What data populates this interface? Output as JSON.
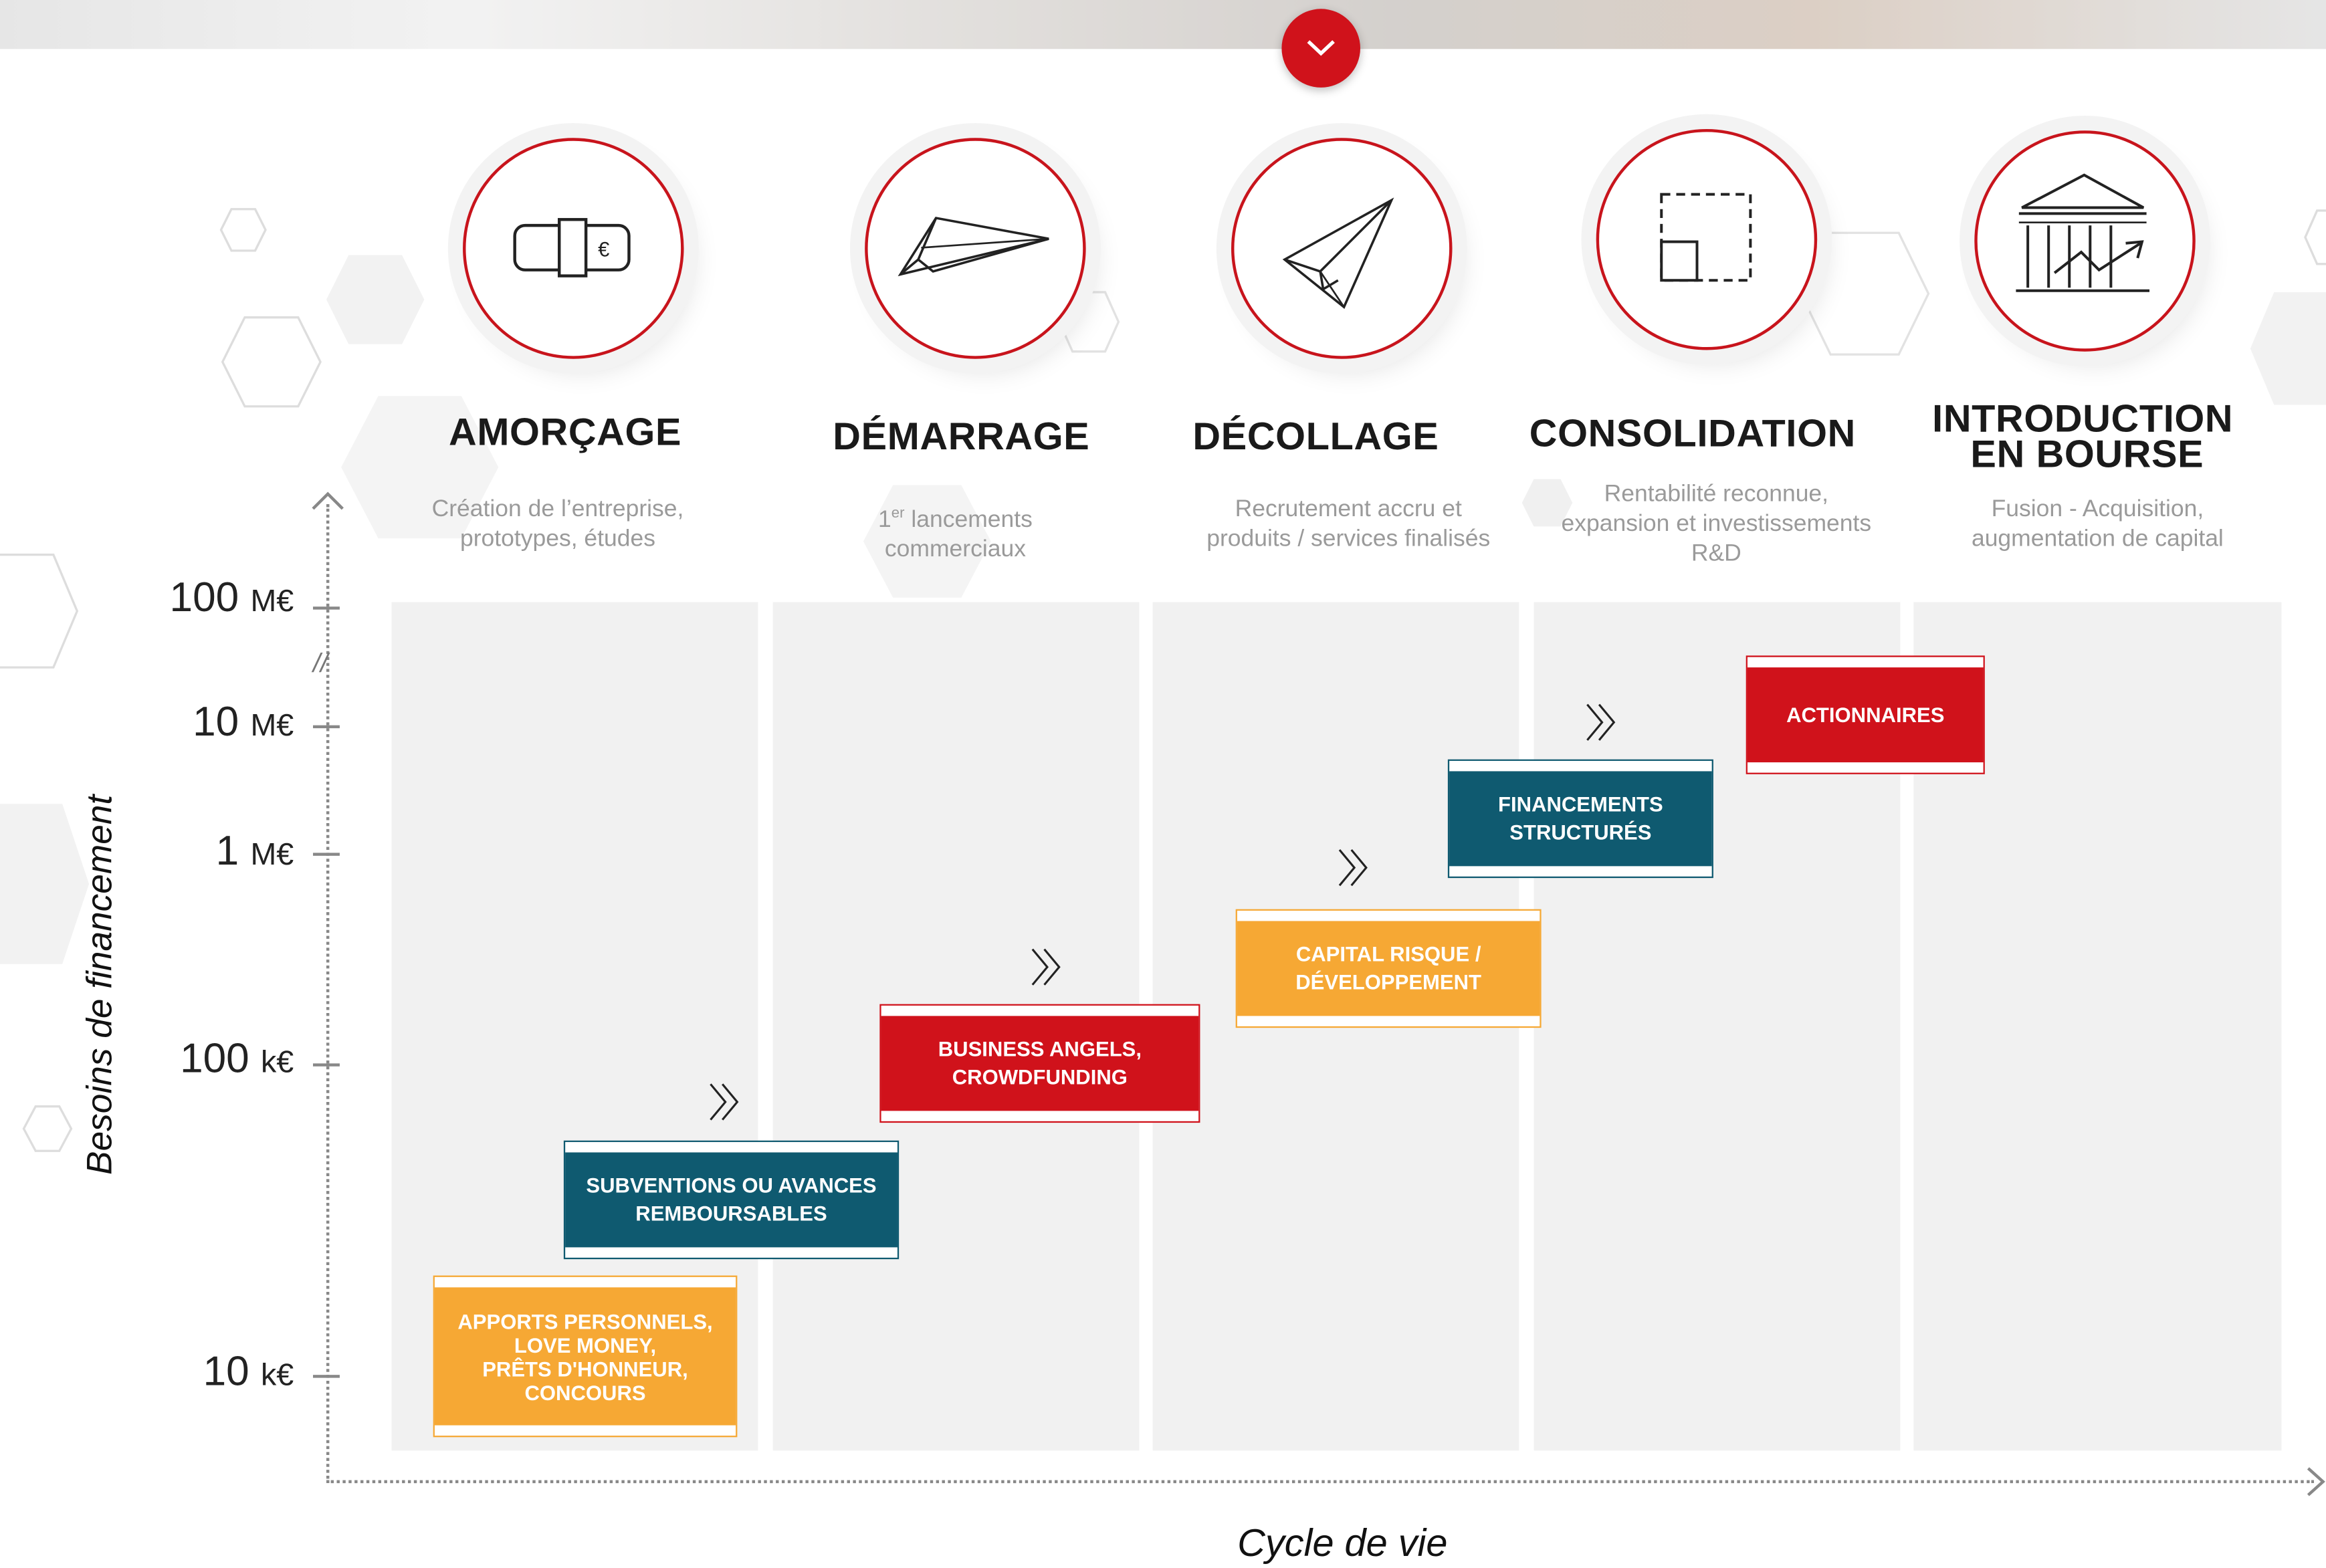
{
  "stages": [
    {
      "title": "AMORÇAGE",
      "desc_line1": "Création de l’entreprise,",
      "desc_line2": "prototypes, études",
      "icon": "banknote-icon"
    },
    {
      "title": "DÉMARRAGE",
      "desc_sup": "1",
      "desc_sup_text": "er",
      "desc_line1": " lancements",
      "desc_line2": "commerciaux",
      "icon": "paper-plane-flat-icon"
    },
    {
      "title": "DÉCOLLAGE",
      "desc_line1": "Recrutement accru et",
      "desc_line2": "produits / services finalisés",
      "icon": "paper-plane-rising-icon"
    },
    {
      "title": "CONSOLIDATION",
      "desc_line1": "Rentabilité reconnue,",
      "desc_line2": "expansion et investissements",
      "desc_line3": "R&D",
      "icon": "expand-square-icon"
    },
    {
      "title_line1": "INTRODUCTION",
      "title_line2": "EN BOURSE",
      "desc_line1": "Fusion - Acquisition,",
      "desc_line2": "augmentation de capital",
      "icon": "stock-exchange-icon"
    }
  ],
  "axis": {
    "y_title": "Besoins de financement",
    "x_title": "Cycle de vie",
    "break_mark": "//",
    "ticks": [
      {
        "value": "100",
        "unit": "M€"
      },
      {
        "value": "10",
        "unit": "M€"
      },
      {
        "value": "1",
        "unit": "M€"
      },
      {
        "value": "100",
        "unit": "k€"
      },
      {
        "value": "10",
        "unit": "k€"
      }
    ]
  },
  "funding": [
    {
      "lines": [
        "APPORTS PERSONNELS,",
        "LOVE MONEY,",
        "PRÊTS D'HONNEUR,",
        "CONCOURS"
      ],
      "color": "#f6a834"
    },
    {
      "lines": [
        "SUBVENTIONS OU AVANCES",
        "REMBOURSABLES"
      ],
      "color": "#0f5a70"
    },
    {
      "lines": [
        "BUSINESS ANGELS,",
        "CROWDFUNDING"
      ],
      "color": "#d0121b"
    },
    {
      "lines": [
        "CAPITAL RISQUE /",
        "DÉVELOPPEMENT"
      ],
      "color": "#f6a834"
    },
    {
      "lines": [
        "FINANCEMENTS",
        "STRUCTURÉS"
      ],
      "color": "#0f5a70"
    },
    {
      "lines": [
        "ACTIONNAIRES"
      ],
      "color": "#d0121b"
    }
  ],
  "colors": {
    "accent_red": "#d0121b",
    "teal": "#0f5a70",
    "orange": "#f6a834"
  }
}
